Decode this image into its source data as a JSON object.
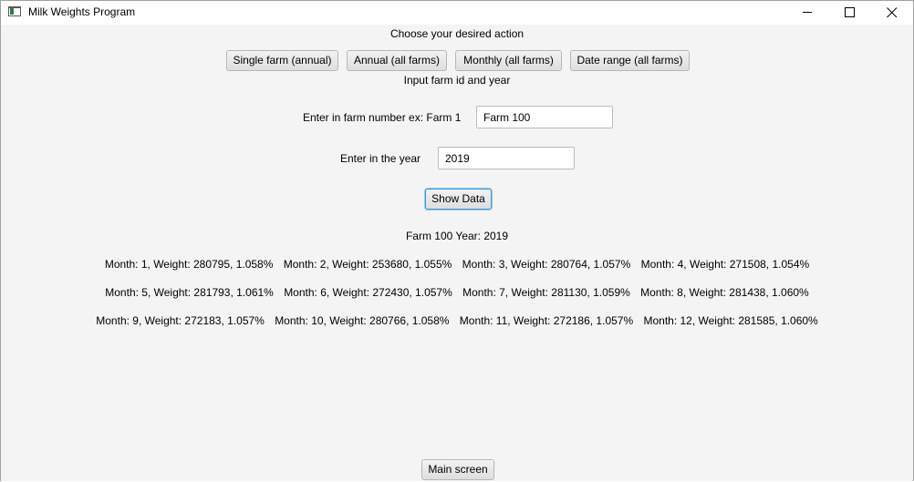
{
  "window": {
    "title": "Milk Weights Program"
  },
  "header": {
    "prompt": "Choose your desired action"
  },
  "actions": {
    "single_farm": "Single farm (annual)",
    "annual_all": "Annual (all farms)",
    "monthly_all": "Monthly (all farms)",
    "date_range": "Date range (all farms)"
  },
  "form": {
    "subtitle": "Input farm id and year",
    "farm_label": "Enter in farm number ex: Farm 1",
    "farm_value": "Farm 100",
    "year_label": "Enter in the year",
    "year_value": "2019",
    "submit_label": "Show Data"
  },
  "results": {
    "heading": "Farm 100 Year: 2019",
    "rows": [
      [
        "Month: 1, Weight: 280795, 1.058%",
        "Month: 2, Weight: 253680, 1.055%",
        "Month: 3, Weight: 280764, 1.057%",
        "Month: 4, Weight: 271508, 1.054%"
      ],
      [
        "Month: 5, Weight: 281793, 1.061%",
        "Month: 6, Weight: 272430, 1.057%",
        "Month: 7, Weight: 281130, 1.059%",
        "Month: 8, Weight: 281438, 1.060%"
      ],
      [
        "Month: 9, Weight: 272183, 1.057%",
        "Month: 10, Weight: 280766, 1.058%",
        "Month: 11, Weight: 272186, 1.057%",
        "Month: 12, Weight: 281585, 1.060%"
      ]
    ]
  },
  "footer": {
    "main_screen_label": "Main screen"
  }
}
